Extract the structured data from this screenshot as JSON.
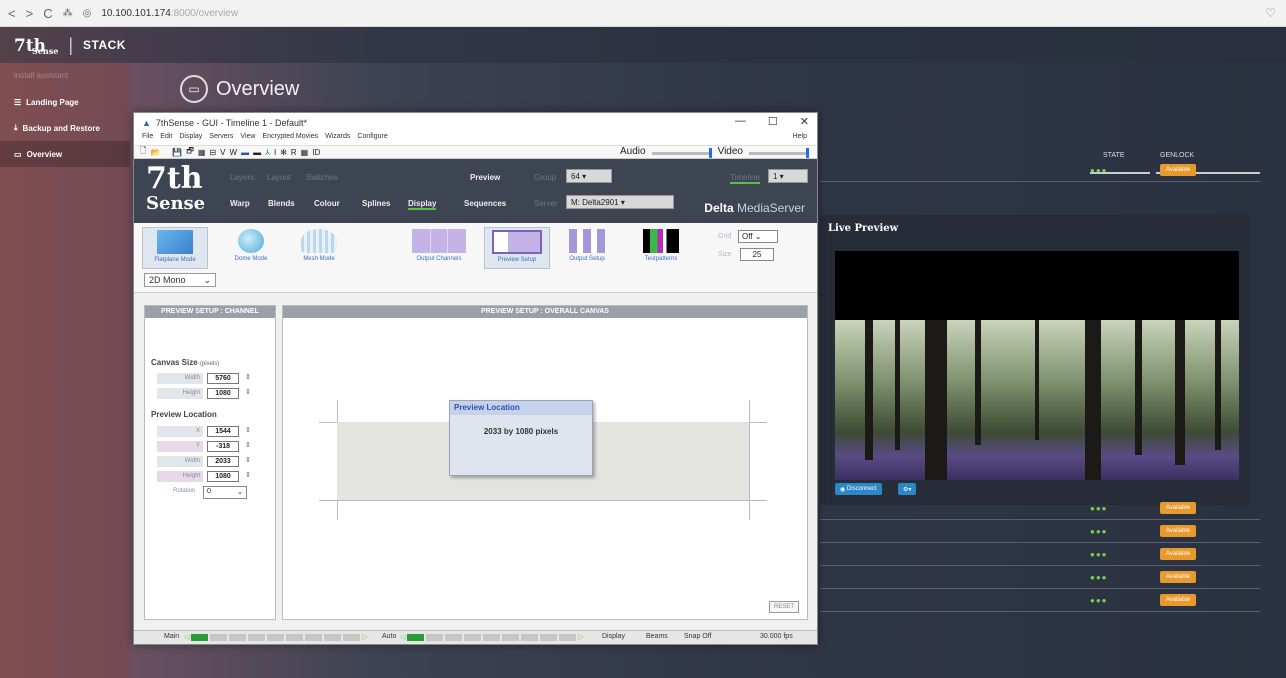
{
  "browser": {
    "nav_icons": [
      "back-icon",
      "forward-icon",
      "reload-icon",
      "apps-icon",
      "site-info-icon"
    ],
    "url_host": "10.100.101.174",
    "url_path": ":8000/overview"
  },
  "stack": {
    "logo": "7th",
    "logo_sub": "Sense",
    "app_name": "STACK",
    "sidebar": {
      "faint_label": "install assistant",
      "items": [
        {
          "label": "Landing Page",
          "icon": "list-icon"
        },
        {
          "label": "Backup and Restore",
          "icon": "download-icon"
        },
        {
          "label": "Overview",
          "icon": "monitor-icon",
          "active": true
        }
      ]
    },
    "page_title": "Overview",
    "table": {
      "col_state": "STATE",
      "col_genlock": "GENLOCK",
      "badge_label": "Available",
      "dots": "●●●"
    },
    "live_preview": {
      "title": "Live Preview",
      "disconnect_label": "Disconnect",
      "settings_label": "⚙▾"
    }
  },
  "gui": {
    "title": "7thSense - GUI - Timeline 1 - Default*",
    "win_buttons": [
      "—",
      "☐",
      "✕"
    ],
    "menus": [
      "File",
      "Edit",
      "Display",
      "Servers",
      "View",
      "Encrypted Movies",
      "Wizards",
      "Configure"
    ],
    "help": "Help",
    "toolbar_items": [
      "🗋",
      "📂",
      "💾",
      "🗗",
      "▦",
      "⊟",
      "V",
      "W",
      "▬",
      "▬",
      "⅄",
      "I",
      "✻",
      "R",
      "▦",
      "ID"
    ],
    "audio_label": "Audio",
    "video_label": "Video",
    "banner": {
      "brand_top": "7th",
      "brand_bottom": "Sense",
      "dim_tabs": [
        "Layers",
        "Layout",
        "Switches"
      ],
      "tabs": [
        "Warp",
        "Blends",
        "Colour",
        "Splines",
        "Display"
      ],
      "active_tab": "Display",
      "preview": "Preview",
      "sequences": "Sequences",
      "group_label": "Group",
      "group_value": "64",
      "server_label": "Server",
      "server_value": "M: Delta2901",
      "timeline_label": "Timeline",
      "timeline_value": "1",
      "delta_bold": "Delta",
      "delta_rest": "MediaServer"
    },
    "ribbon": {
      "buttons": [
        {
          "label": "Flatplane Mode",
          "icon": "flatplane-icon"
        },
        {
          "label": "Dome Mode",
          "icon": "dome-icon"
        },
        {
          "label": "Mesh Mode",
          "icon": "mesh-icon"
        },
        {
          "label": "Output Channels",
          "icon": "output-channels-icon"
        },
        {
          "label": "Preview Setup",
          "icon": "preview-setup-icon"
        },
        {
          "label": "Output Setup",
          "icon": "output-setup-icon"
        },
        {
          "label": "Testpatterns",
          "icon": "testpatterns-icon"
        }
      ],
      "mono_select": "2D Mono",
      "grid_label": "Grid",
      "grid_value": "Off",
      "size_label": "Size",
      "size_value": "25"
    },
    "channel_panel": {
      "header": "PREVIEW SETUP : CHANNEL",
      "canvas_size": "Canvas Size",
      "canvas_size_unit": "(pixels)",
      "width_label": "Width",
      "width_value": "5760",
      "height_label": "Height",
      "height_value": "1080",
      "preview_location": "Preview Location",
      "x_label": "X",
      "x_value": "1544",
      "y_label": "Y",
      "y_value": "-318",
      "pw_label": "Width",
      "pw_value": "2033",
      "ph_label": "Height",
      "ph_value": "1080",
      "rotation_label": "Rotation",
      "rotation_value": "0"
    },
    "canvas_panel": {
      "header": "PREVIEW SETUP : OVERALL CANVAS",
      "popup_title": "Preview Location",
      "popup_text": "2033 by 1080 pixels",
      "reset": "RESET"
    },
    "statusbar": {
      "main": "Main",
      "auto": "Auto",
      "display": "Display",
      "beams": "Beams",
      "snap": "Snap Off",
      "fps": "30.000 fps"
    }
  }
}
